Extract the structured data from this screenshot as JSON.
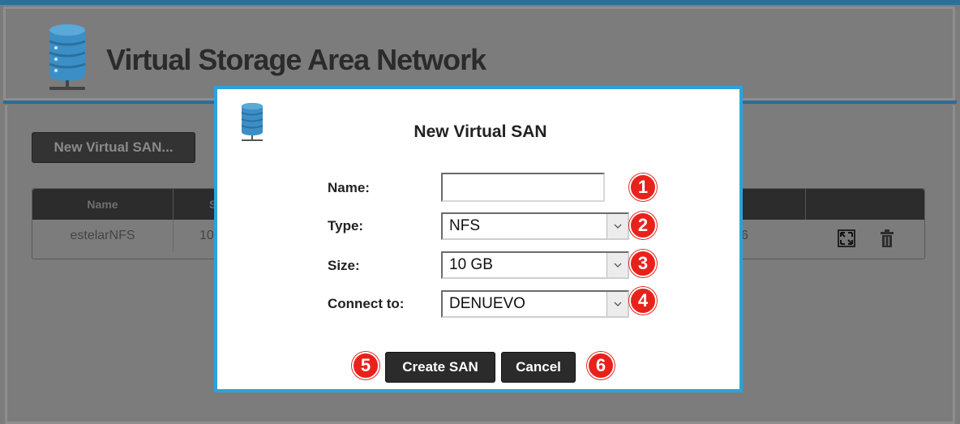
{
  "app": {
    "title": "Virtual Storage Area Network"
  },
  "toolbar": {
    "new_san_label": "New Virtual SAN..."
  },
  "table": {
    "headers": {
      "name": "Name",
      "size_partial": "S"
    },
    "rows": [
      {
        "name": "estelarNFS",
        "size_partial": "10",
        "tail_partial": "6"
      }
    ]
  },
  "modal": {
    "title": "New Virtual SAN",
    "fields": {
      "name": {
        "label": "Name:",
        "value": ""
      },
      "type": {
        "label": "Type:",
        "value": "NFS"
      },
      "size": {
        "label": "Size:",
        "value": "10 GB"
      },
      "connect_to": {
        "label": "Connect to:",
        "value": "DENUEVO"
      }
    },
    "buttons": {
      "create": "Create SAN",
      "cancel": "Cancel"
    },
    "callouts": [
      "1",
      "2",
      "3",
      "4",
      "5",
      "6"
    ]
  },
  "colors": {
    "accent": "#2aa3dc",
    "header_line": "#2a6c93",
    "callout": "#e8221b"
  },
  "icons": {
    "app": "database-server-icon",
    "modal": "database-server-icon",
    "expand": "expand-icon",
    "delete": "trash-icon",
    "dropdown": "chevron-down-icon"
  }
}
